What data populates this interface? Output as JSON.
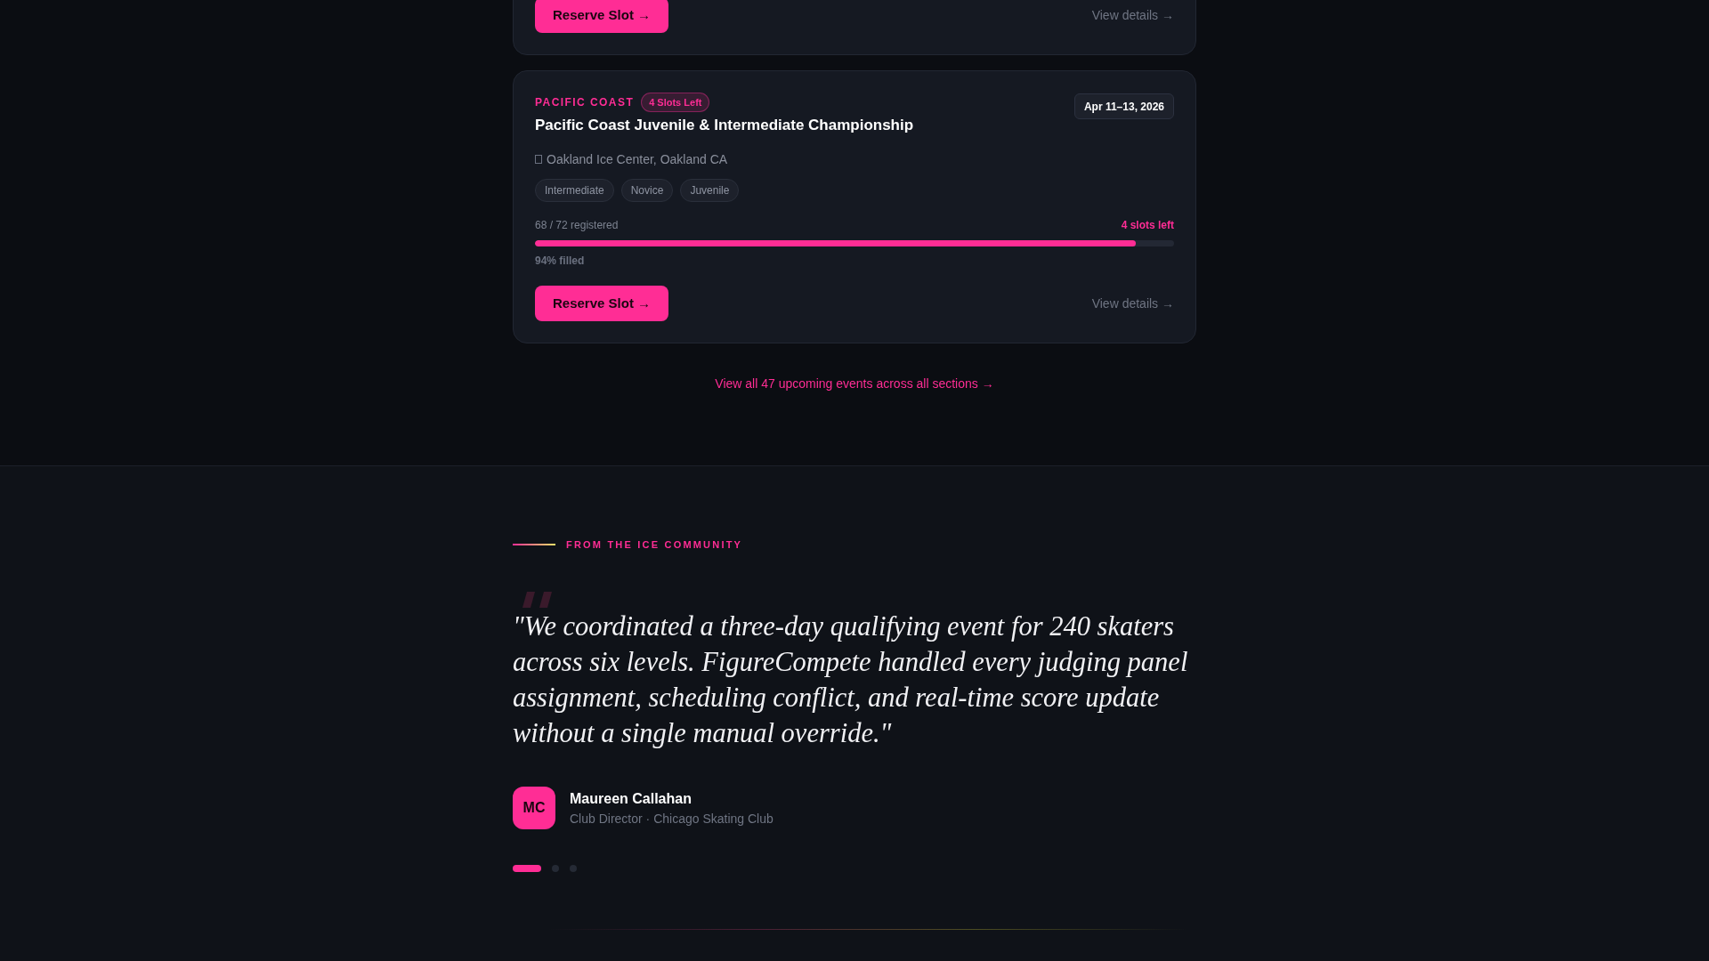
{
  "events": [
    {
      "actions": {
        "reserve": "Reserve Slot →",
        "details": "View details →"
      }
    },
    {
      "region": "PACIFIC COAST",
      "badge": "4 Slots Left",
      "title": "Pacific Coast Juvenile & Intermediate Championship",
      "date": "Apr 11–13, 2026",
      "location": "Oakland Ice Center, Oakland CA",
      "levels": [
        "Intermediate",
        "Novice",
        "Juvenile"
      ],
      "registered": "68 / 72 registered",
      "slots_left": "4 slots left",
      "level": 0.94,
      "filled": "94% filled",
      "actions": {
        "reserve": "Reserve Slot →",
        "details": "View details →"
      }
    }
  ],
  "view_all_link": "View all 47 upcoming events across all sections →",
  "testimonial": {
    "eyebrow": "FROM THE ICE COMMUNITY",
    "quote": "\"We coordinated a three-day qualifying event for 240 skaters across six levels. FigureCompete handled every judging panel assignment, scheduling conflict, and real-time score update without a single manual override.\"",
    "author": {
      "initials": "MC",
      "name": "Maureen Callahan",
      "role": "Club Director · Chicago Skating Club"
    },
    "dots": [
      {
        "selected": true
      },
      {
        "selected": false
      },
      {
        "selected": false
      }
    ]
  }
}
